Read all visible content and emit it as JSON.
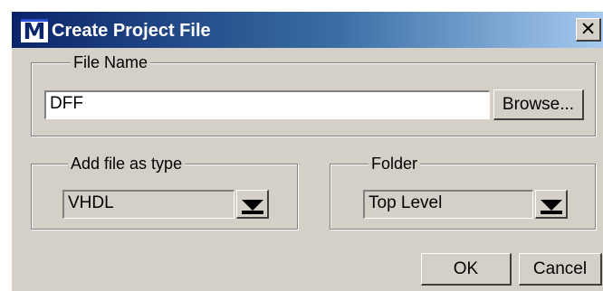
{
  "window": {
    "title": "Create Project File",
    "icon_letter": "M",
    "close_glyph": "✕"
  },
  "file_name_group": {
    "legend": "File Name",
    "value": "DFF",
    "browse_label": "Browse..."
  },
  "type_group": {
    "legend": "Add file as type",
    "selected": "VHDL"
  },
  "folder_group": {
    "legend": "Folder",
    "selected": "Top Level"
  },
  "buttons": {
    "ok_label": "OK",
    "cancel_label": "Cancel"
  },
  "colors": {
    "face": "#d4d0c8",
    "title_start": "#0a246a",
    "title_end": "#a6caf0"
  }
}
